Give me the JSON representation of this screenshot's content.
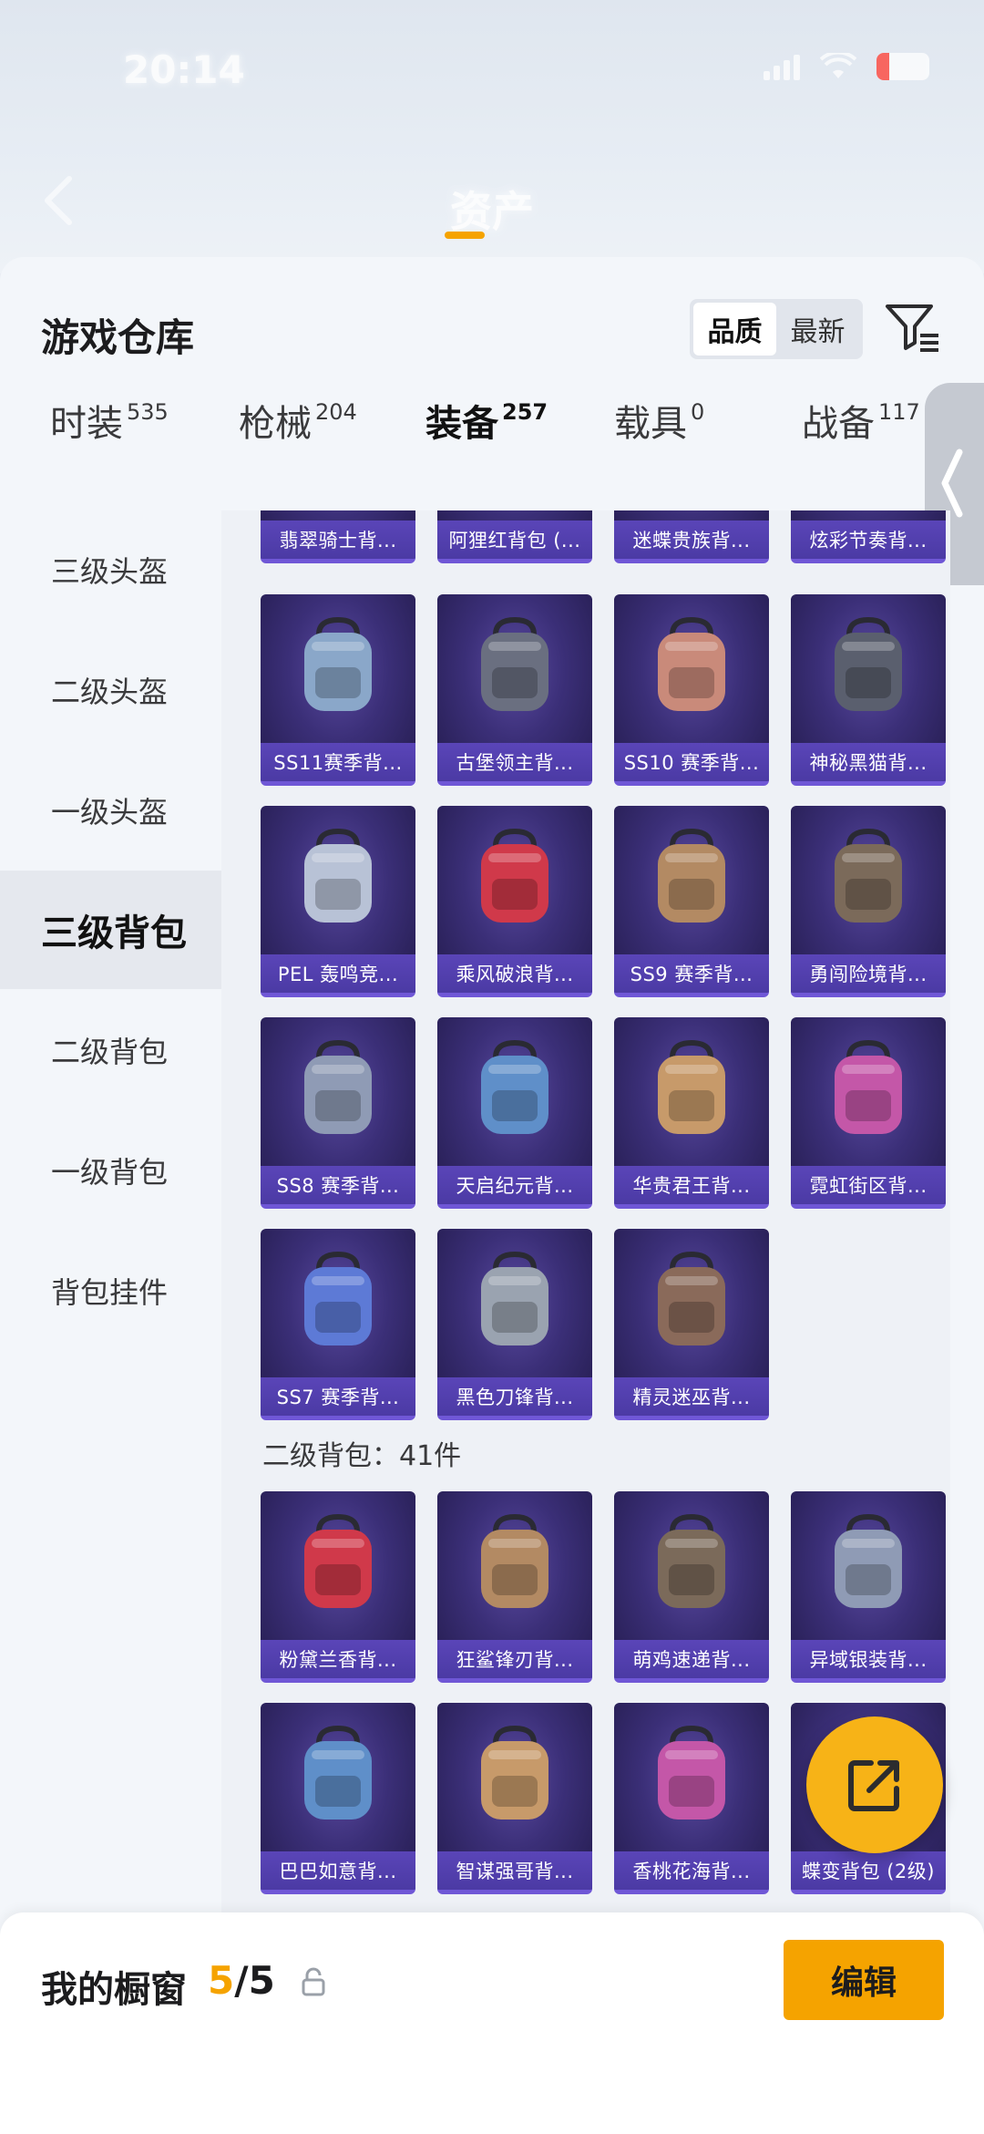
{
  "status_bar": {
    "time": "20:14"
  },
  "nav": {
    "title": "资产"
  },
  "sheet": {
    "title": "游戏仓库",
    "sort_options": [
      "品质",
      "最新"
    ],
    "active_sort": "品质"
  },
  "tabs": [
    {
      "label": "时装",
      "count": "535"
    },
    {
      "label": "枪械",
      "count": "204"
    },
    {
      "label": "装备",
      "count": "257"
    },
    {
      "label": "载具",
      "count": "0"
    },
    {
      "label": "战备",
      "count": "117"
    }
  ],
  "active_tab": "装备",
  "sidebar": {
    "items": [
      {
        "label": "三级头盔"
      },
      {
        "label": "二级头盔"
      },
      {
        "label": "一级头盔"
      },
      {
        "label": "三级背包"
      },
      {
        "label": "二级背包"
      },
      {
        "label": "一级背包"
      },
      {
        "label": "背包挂件"
      }
    ],
    "active": "三级背包"
  },
  "grid": {
    "top_row": [
      "翡翠骑士背...",
      "阿狸红背包 (...",
      "迷蝶贵族背...",
      "炫彩节奏背..."
    ],
    "level3_items": [
      "SS11赛季背...",
      "古堡领主背...",
      "SS10 赛季背...",
      "神秘黑猫背...",
      "PEL 轰鸣竞...",
      "乘风破浪背...",
      "SS9 赛季背...",
      "勇闯险境背...",
      "SS8 赛季背...",
      "天启纪元背...",
      "华贵君王背...",
      "霓虹街区背...",
      "SS7 赛季背...",
      "黑色刀锋背...",
      "精灵迷巫背..."
    ],
    "section_label": "二级背包：41件",
    "level2_items": [
      "粉黛兰香背...",
      "狂鲨锋刃背...",
      "萌鸡速递背...",
      "异域银装背...",
      "巴巴如意背...",
      "智谋强哥背...",
      "香桃花海背...",
      "蝶变背包 (2级)"
    ]
  },
  "bottom_bar": {
    "title": "我的橱窗",
    "current": "5",
    "total": "/5",
    "edit_label": "编辑"
  },
  "colors": {
    "accent": "#f5a300",
    "card_bg": "#3b2f78",
    "card_label": "#4b3aa4",
    "fab": "#f7b317"
  }
}
